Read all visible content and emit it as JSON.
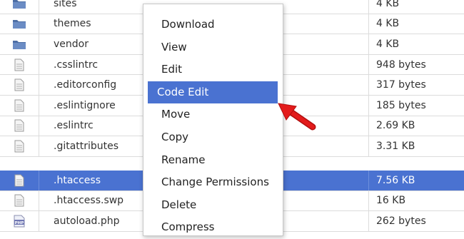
{
  "colors": {
    "selection": "#4a72d1",
    "arrow": "#e31b1b",
    "folder": "#4d6ea5"
  },
  "files": [
    {
      "name": "sites",
      "size": "4 KB",
      "icon": "folder-icon",
      "selected": false
    },
    {
      "name": "themes",
      "size": "4 KB",
      "icon": "folder-icon",
      "selected": false
    },
    {
      "name": "vendor",
      "size": "4 KB",
      "icon": "folder-icon",
      "selected": false
    },
    {
      "name": ".csslintrc",
      "size": "948 bytes",
      "icon": "text-file-icon",
      "selected": false
    },
    {
      "name": ".editorconfig",
      "size": "317 bytes",
      "icon": "text-file-icon",
      "selected": false
    },
    {
      "name": ".eslintignore",
      "size": "185 bytes",
      "icon": "text-file-icon",
      "selected": false
    },
    {
      "name": ".eslintrc",
      "size": "2.69 KB",
      "icon": "text-file-icon",
      "selected": false
    },
    {
      "name": ".gitattributes",
      "size": "3.31 KB",
      "icon": "text-file-icon",
      "selected": false
    },
    {
      "name": ".htaccess",
      "size": "7.56 KB",
      "icon": "text-file-icon",
      "selected": true
    },
    {
      "name": ".htaccess.swp",
      "size": "16 KB",
      "icon": "text-file-icon",
      "selected": false
    },
    {
      "name": "autoload.php",
      "size": "262 bytes",
      "icon": "php-file-icon",
      "selected": false
    }
  ],
  "context_menu": {
    "items": [
      {
        "label": "Download",
        "active": false
      },
      {
        "label": "View",
        "active": false
      },
      {
        "label": "Edit",
        "active": false
      },
      {
        "label": "Code Edit",
        "active": true
      },
      {
        "label": "Move",
        "active": false
      },
      {
        "label": "Copy",
        "active": false
      },
      {
        "label": "Rename",
        "active": false
      },
      {
        "label": "Change Permissions",
        "active": false
      },
      {
        "label": "Delete",
        "active": false
      },
      {
        "label": "Compress",
        "active": false
      }
    ]
  },
  "php_icon_text": "PHP"
}
